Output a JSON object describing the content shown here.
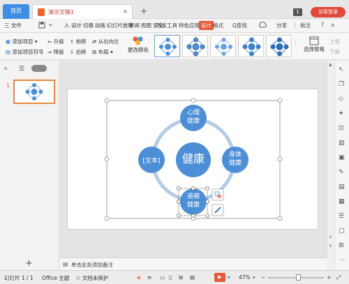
{
  "titlebar": {
    "home_tab": "首页",
    "doc_tab": "演示文稿1",
    "close_glyph": "×",
    "new_tab_glyph": "+",
    "page_badge": "1",
    "visitor_login": "访客登录"
  },
  "menubar": {
    "file_menu": "三 文件",
    "collapse": "»",
    "items": [
      "入",
      "设计",
      "切换",
      "动画",
      "幻灯片放映",
      "审阅",
      "视图",
      "安全",
      "开发工具",
      "特色应用"
    ],
    "active_tab": "设计",
    "format_tab": "格式",
    "search": "Q查找",
    "share": "分享",
    "comment": "批注"
  },
  "toolbar": {
    "add_item": "添加项目",
    "add_item_bullet": "添加项目符号",
    "promote": "升级",
    "demote": "降级",
    "move_forward": "前移",
    "move_backward": "后移",
    "right_to_left": "从右向左",
    "layout": "布局",
    "change_color": "更改颜色",
    "select_pane": "选择窗格",
    "up_one": "上移",
    "down_one": "下移"
  },
  "leftpanel": {
    "collapse_glyph": "«",
    "slide_number": "1",
    "add_slide_glyph": "+"
  },
  "diagram": {
    "center": "健康",
    "top_line1": "心理",
    "top_line2": "健康",
    "left": "[文本]",
    "right_line1": "身体",
    "right_line2": "健康",
    "bottom_line1": "道德",
    "bottom_line2": "健康"
  },
  "notes": {
    "placeholder": "单击此处添加备注"
  },
  "statusbar": {
    "slide_counter": "幻灯片 1 / 1",
    "theme": "Office 主题",
    "doc_protect": "文档未保护",
    "zoom": "47%",
    "zoom_minus": "−",
    "zoom_plus": "+"
  },
  "colors": {
    "circle_blue": "#4d8fd6",
    "ring_blue": "#b3cbe6",
    "accent_red": "#e55a3a"
  }
}
